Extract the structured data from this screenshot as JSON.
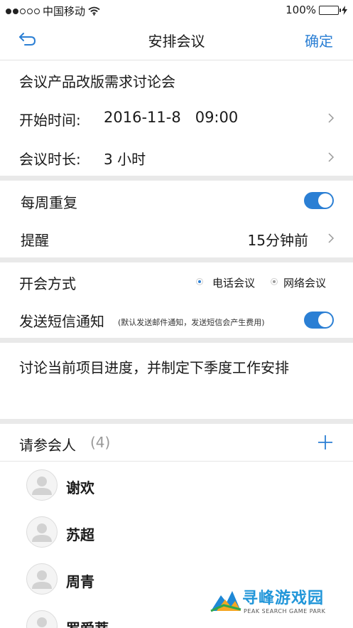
{
  "status": {
    "carrier": "中国移动",
    "battery": "100%"
  },
  "nav": {
    "title": "安排会议",
    "confirm": "确定"
  },
  "meeting": {
    "name": "会议产品改版需求讨论会",
    "start_label": "开始时间:",
    "start_value": "2016-11-8   09:00",
    "duration_label": "会议时长:",
    "duration_value": "3 小时"
  },
  "repeat": {
    "label": "每周重复",
    "enabled": true
  },
  "reminder": {
    "label": "提醒",
    "value": "15分钟前"
  },
  "mode": {
    "label": "开会方式",
    "options": [
      {
        "label": "电话会议",
        "selected": true
      },
      {
        "label": "网络会议",
        "selected": false
      }
    ]
  },
  "sms": {
    "label": "发送短信通知",
    "note": "(默认发送邮件通知，发送短信会产生费用)",
    "enabled": true
  },
  "description": "讨论当前项目进度，并制定下季度工作安排",
  "participants": {
    "label": "请参会人",
    "count": "(4)",
    "people": [
      "谢欢",
      "苏超",
      "周青",
      "罗爱蒂"
    ]
  },
  "watermark": {
    "title": "寻峰游戏园",
    "subtitle": "PEAK SEARCH GAME PARK"
  },
  "colors": {
    "accent": "#2b7fd4",
    "battery": "#4cd964",
    "divider": "#e9e9e9"
  }
}
